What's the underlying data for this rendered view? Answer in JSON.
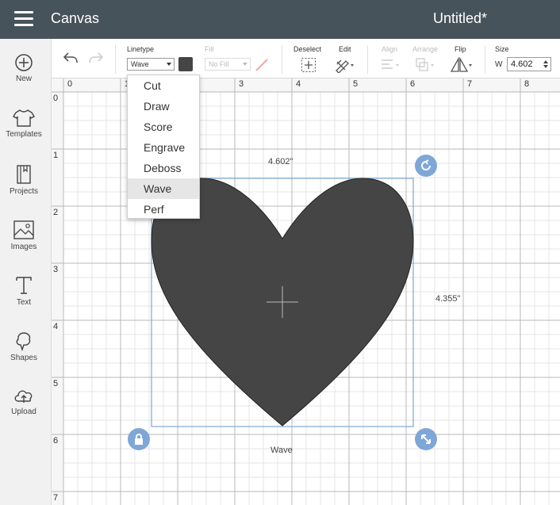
{
  "header": {
    "app_title": "Canvas",
    "doc_title": "Untitled*"
  },
  "sidebar": {
    "items": [
      {
        "label": "New",
        "icon": "plus-circle-icon"
      },
      {
        "label": "Templates",
        "icon": "shirt-icon"
      },
      {
        "label": "Projects",
        "icon": "book-icon"
      },
      {
        "label": "Images",
        "icon": "image-icon"
      },
      {
        "label": "Text",
        "icon": "text-icon"
      },
      {
        "label": "Shapes",
        "icon": "shapes-icon"
      },
      {
        "label": "Upload",
        "icon": "cloud-upload-icon"
      }
    ]
  },
  "toolbar": {
    "linetype_label": "Linetype",
    "linetype_value": "Wave",
    "linetype_color": "#454545",
    "fill_label": "Fill",
    "fill_value": "No Fill",
    "deselect_label": "Deselect",
    "edit_label": "Edit",
    "align_label": "Align",
    "arrange_label": "Arrange",
    "flip_label": "Flip",
    "size_label": "Size",
    "width_prefix": "W",
    "width_value": "4.602"
  },
  "linetype_menu": {
    "options": [
      "Cut",
      "Draw",
      "Score",
      "Engrave",
      "Deboss",
      "Wave",
      "Perf"
    ],
    "selected": "Wave"
  },
  "ruler": {
    "x": [
      "0",
      "1",
      "3",
      "4",
      "5",
      "6",
      "7",
      "8"
    ],
    "y": [
      "0",
      "1",
      "2",
      "3",
      "4",
      "5",
      "6",
      "7"
    ]
  },
  "object": {
    "width_label": "4.602\"",
    "height_label": "4.355\"",
    "linetype_caption": "Wave",
    "fill_color": "#454545",
    "selection_color": "#7ea7d8"
  }
}
